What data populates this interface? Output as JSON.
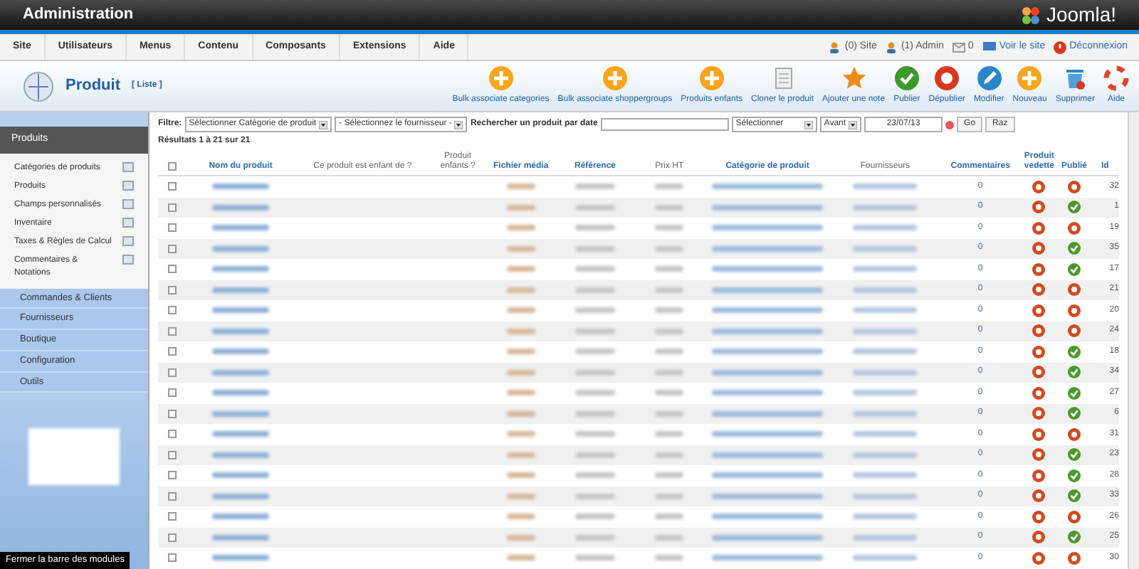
{
  "header": {
    "title": "Administration",
    "logo_text": "Joomla!"
  },
  "menu": {
    "items": [
      "Site",
      "Utilisateurs",
      "Menus",
      "Contenu",
      "Composants",
      "Extensions",
      "Aide"
    ],
    "status": [
      {
        "kind": "users",
        "label": "(0) Site"
      },
      {
        "kind": "users",
        "label": "(1) Admin"
      },
      {
        "kind": "mail",
        "label": "0"
      },
      {
        "kind": "view",
        "label": "Voir le site"
      },
      {
        "kind": "logout",
        "label": "Déconnexion"
      }
    ]
  },
  "toolbar": {
    "title": "Produit",
    "subtitle": "[ Liste ]",
    "buttons": [
      {
        "kind": "plus",
        "label": "Bulk associate categories"
      },
      {
        "kind": "plus",
        "label": "Bulk associate shoppergroups"
      },
      {
        "kind": "plus",
        "label": "Produits enfants"
      },
      {
        "kind": "copy",
        "label": "Cloner le produit"
      },
      {
        "kind": "star",
        "label": "Ajouter une note"
      },
      {
        "kind": "check",
        "label": "Publier"
      },
      {
        "kind": "stop",
        "label": "Dépublier"
      },
      {
        "kind": "pencil",
        "label": "Modifier"
      },
      {
        "kind": "plus",
        "label": "Nouveau"
      },
      {
        "kind": "trash",
        "label": "Supprimer"
      },
      {
        "kind": "help",
        "label": "Aide"
      }
    ]
  },
  "sidebar": {
    "section": "Produits",
    "items": [
      "Catégories de produits",
      "Produits",
      "Champs personnalisés",
      "Inventaire",
      "Taxes & Règles de Calcul",
      "Commentaires & Notations"
    ],
    "groups": [
      "Commandes & Clients",
      "Fournisseurs",
      "Boutique",
      "Configuration",
      "Outils"
    ],
    "tooltip": "Fermer la barre des modules"
  },
  "filter": {
    "label": "Filtre:",
    "category": "Sélectionner Catégorie de produit",
    "supplier": "- Sélectionnez le fournisseur -",
    "date_label": "Rechercher un produit par date",
    "select": "Sélectionner",
    "when": "Avant",
    "date": "23/07/13",
    "go": "Go",
    "reset": "Raz",
    "results": "Résultats 1 à 21 sur 21"
  },
  "select_all": {
    "checked": false
  },
  "columns": [
    "Nom du produit",
    "Ce produit est enfant de ?",
    "Produit enfants ?",
    "Fichier média",
    "Référence",
    "Prix HT",
    "Catégorie de produit",
    "Fournisseurs",
    "Commentaires",
    "Produit vedette",
    "Publié",
    "Id"
  ],
  "rows": [
    {
      "checked": false,
      "comments": "0",
      "featured": false,
      "published": false,
      "id": "32"
    },
    {
      "checked": false,
      "comments": "0",
      "featured": false,
      "published": true,
      "id": "1"
    },
    {
      "checked": false,
      "comments": "0",
      "featured": false,
      "published": false,
      "id": "19"
    },
    {
      "checked": false,
      "comments": "0",
      "featured": false,
      "published": true,
      "id": "35"
    },
    {
      "checked": false,
      "comments": "0",
      "featured": false,
      "published": true,
      "id": "17"
    },
    {
      "checked": false,
      "comments": "0",
      "featured": false,
      "published": false,
      "id": "21"
    },
    {
      "checked": false,
      "comments": "0",
      "featured": false,
      "published": false,
      "id": "20"
    },
    {
      "checked": false,
      "comments": "0",
      "featured": false,
      "published": false,
      "id": "24"
    },
    {
      "checked": false,
      "comments": "0",
      "featured": false,
      "published": true,
      "id": "18"
    },
    {
      "checked": false,
      "comments": "0",
      "featured": false,
      "published": true,
      "id": "34"
    },
    {
      "checked": false,
      "comments": "0",
      "featured": false,
      "published": true,
      "id": "27"
    },
    {
      "checked": false,
      "comments": "0",
      "featured": false,
      "published": true,
      "id": "6"
    },
    {
      "checked": false,
      "comments": "0",
      "featured": false,
      "published": false,
      "id": "31"
    },
    {
      "checked": false,
      "comments": "0",
      "featured": false,
      "published": true,
      "id": "23"
    },
    {
      "checked": false,
      "comments": "0",
      "featured": false,
      "published": true,
      "id": "28"
    },
    {
      "checked": false,
      "comments": "0",
      "featured": false,
      "published": true,
      "id": "33"
    },
    {
      "checked": false,
      "comments": "0",
      "featured": false,
      "published": false,
      "id": "26"
    },
    {
      "checked": false,
      "comments": "0",
      "featured": false,
      "published": true,
      "id": "25"
    },
    {
      "checked": false,
      "comments": "0",
      "featured": false,
      "published": false,
      "id": "30"
    }
  ]
}
